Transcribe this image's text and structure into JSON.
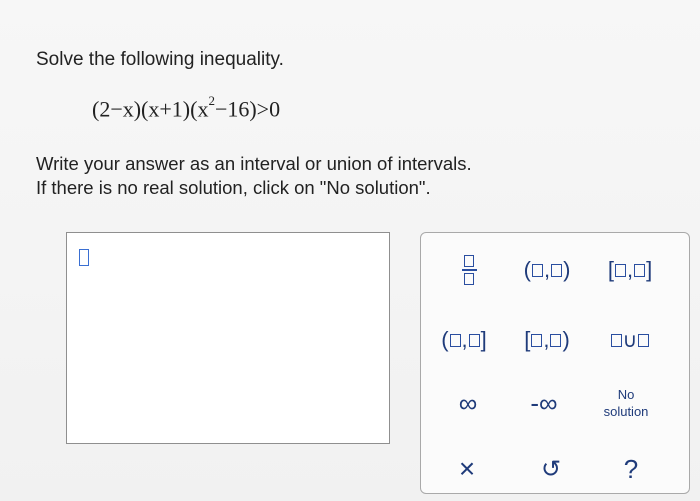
{
  "question": {
    "prompt": "Solve the following inequality.",
    "equation": {
      "part1": "(2−x)(x+1)(x",
      "exponent": "2",
      "part2": "−16)>0"
    },
    "instructions": [
      "Write your answer as an interval or union of intervals.",
      "If there is no real solution, click on \"No solution\"."
    ]
  },
  "answer": {
    "value": ""
  },
  "keypad": {
    "keys": {
      "fraction": "fraction-template",
      "open_interval_open": [
        "(",
        ",",
        ")"
      ],
      "closed_interval_closed": [
        "[",
        ",",
        "]"
      ],
      "open_interval_closed": [
        "(",
        ",",
        "]"
      ],
      "closed_interval_open": [
        "[",
        ",",
        ")"
      ],
      "union": "∪",
      "infinity": "∞",
      "neg_infinity": "-∞",
      "no_solution_line1": "No",
      "no_solution_line2": "solution",
      "clear": "×",
      "undo": "↺",
      "help": "?"
    }
  },
  "colors": {
    "key_text": "#1f3b7a",
    "caret_border": "#3a6fd2",
    "box_border": "#8f8f8f",
    "background": "#f4f4f4"
  }
}
